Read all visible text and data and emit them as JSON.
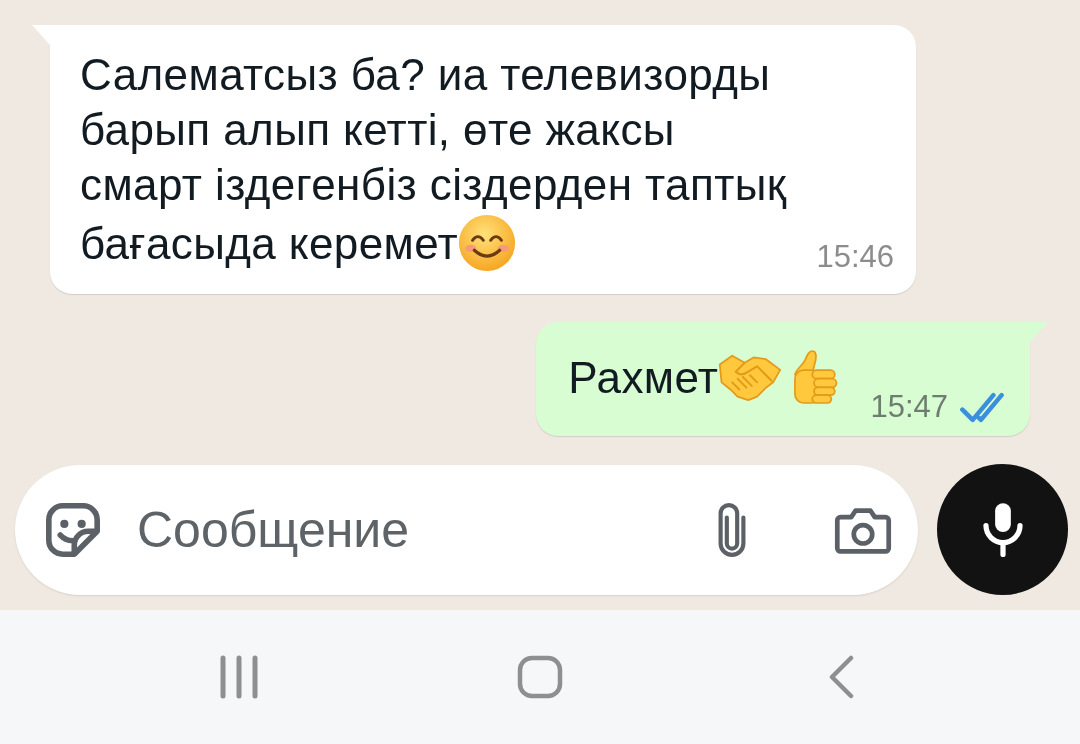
{
  "messages": [
    {
      "kind": "incoming",
      "lines": [
        "Салематсыз ба? иа телевизорды",
        "барып алып кетті, өте жаксы",
        "смарт іздегенбіз сіздерден таптық",
        "бағасыда керемет"
      ],
      "emojis": [
        {
          "kind": "smiling_face"
        }
      ],
      "time": "15:46"
    },
    {
      "kind": "outgoing",
      "lines": [
        "Рахмет"
      ],
      "emojis": [
        {
          "kind": "handshake"
        },
        {
          "kind": "thumbs_up"
        }
      ],
      "time": "15:47",
      "read": true
    }
  ],
  "composer": {
    "placeholder": "Сообщение"
  }
}
